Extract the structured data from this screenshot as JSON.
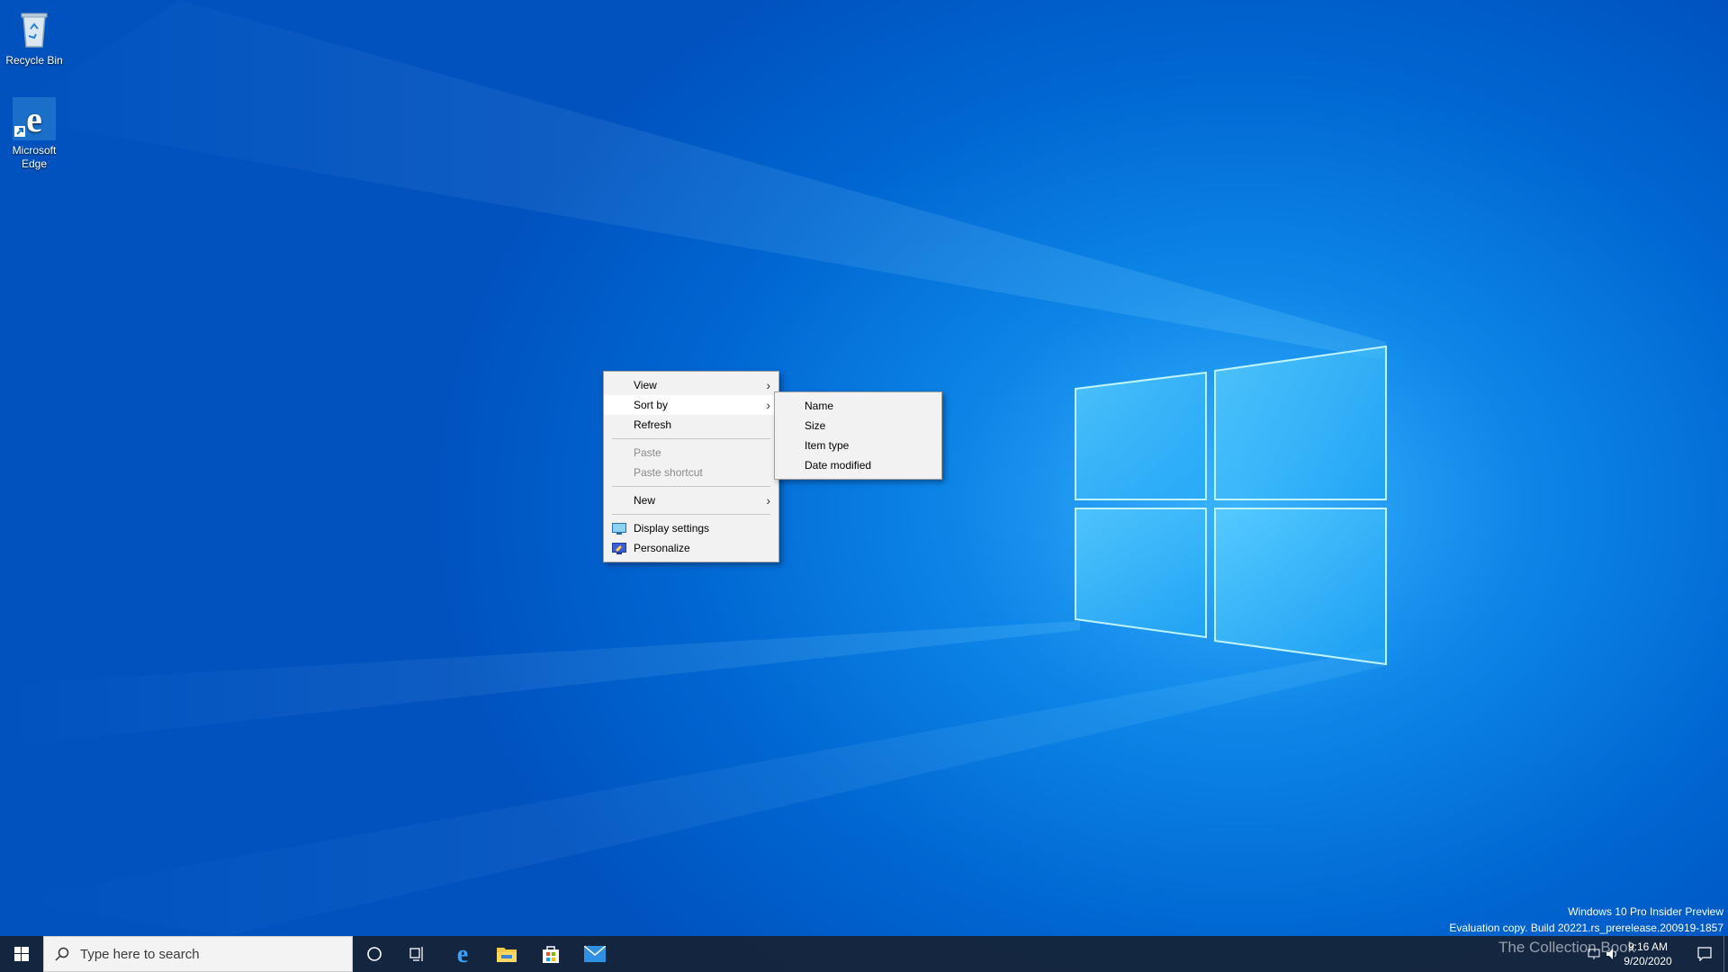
{
  "desktop": {
    "icons": [
      {
        "label": "Recycle Bin",
        "icon": "recycle-bin-icon"
      },
      {
        "label": "Microsoft Edge",
        "icon": "edge-icon"
      }
    ]
  },
  "context_menu": {
    "items": [
      {
        "label": "View",
        "submenu": true
      },
      {
        "label": "Sort by",
        "submenu": true,
        "highlighted": true
      },
      {
        "label": "Refresh"
      },
      {
        "label": "Paste",
        "disabled": true
      },
      {
        "label": "Paste shortcut",
        "disabled": true
      },
      {
        "label": "New",
        "submenu": true
      },
      {
        "label": "Display settings",
        "icon": "display-icon"
      },
      {
        "label": "Personalize",
        "icon": "personalize-icon"
      }
    ]
  },
  "sort_submenu": {
    "items": [
      "Name",
      "Size",
      "Item type",
      "Date modified"
    ]
  },
  "watermark": {
    "line1": "Windows 10 Pro Insider Preview",
    "line2": "Evaluation copy. Build 20221.rs_prerelease.200919-1857"
  },
  "taskbar": {
    "search_placeholder": "Type here to search",
    "pinned": [
      "cortana-icon",
      "task-view-icon",
      "edge-icon",
      "file-explorer-icon",
      "store-icon",
      "mail-icon"
    ],
    "time": "9:16 AM",
    "date": "9/20/2020",
    "tray_watermark": "The Collection Book"
  },
  "colors": {
    "accent": "#0078d7",
    "taskbar": "#162234",
    "menu_bg": "#f2f2f2"
  }
}
